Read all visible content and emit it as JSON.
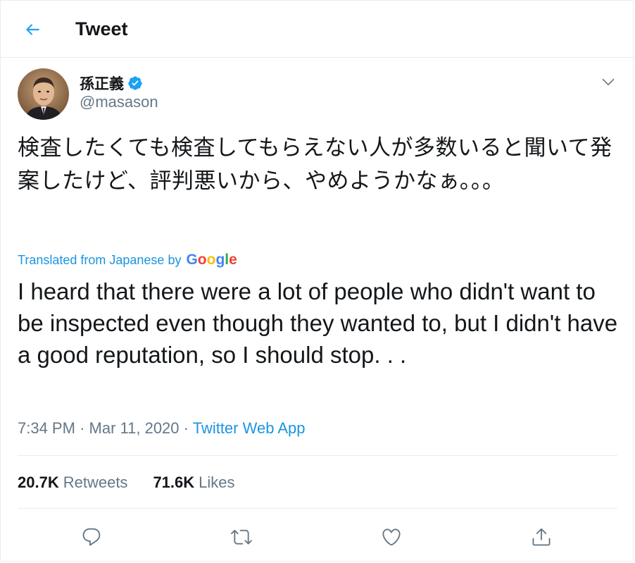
{
  "header": {
    "title": "Tweet",
    "back_icon": "arrow-left-icon"
  },
  "author": {
    "display_name": "孫正義",
    "username": "@masason",
    "verified": true
  },
  "tweet": {
    "text": "検査したくても検査してもらえない人が多数いると聞いて発案したけど、評判悪いから、やめようかなぁ。。。",
    "translated_label": "Translated from Japanese by",
    "translation_provider": "Google",
    "translation": "I heard that there were a lot of people who didn't want to be inspected even though they wanted to, but I didn't have a good reputation, so I should stop. . ."
  },
  "meta": {
    "time": "7:34 PM",
    "separator": "·",
    "date": "Mar 11, 2020",
    "source": "Twitter Web App"
  },
  "stats": {
    "retweets_count": "20.7K",
    "retweets_label": "Retweets",
    "likes_count": "71.6K",
    "likes_label": "Likes"
  },
  "actions": [
    "reply-icon",
    "retweet-icon",
    "like-icon",
    "share-icon"
  ],
  "colors": {
    "accent": "#1da1f2",
    "link": "#1b95e0",
    "muted": "#657786",
    "text": "#14171a",
    "border": "#e6ecf0"
  }
}
